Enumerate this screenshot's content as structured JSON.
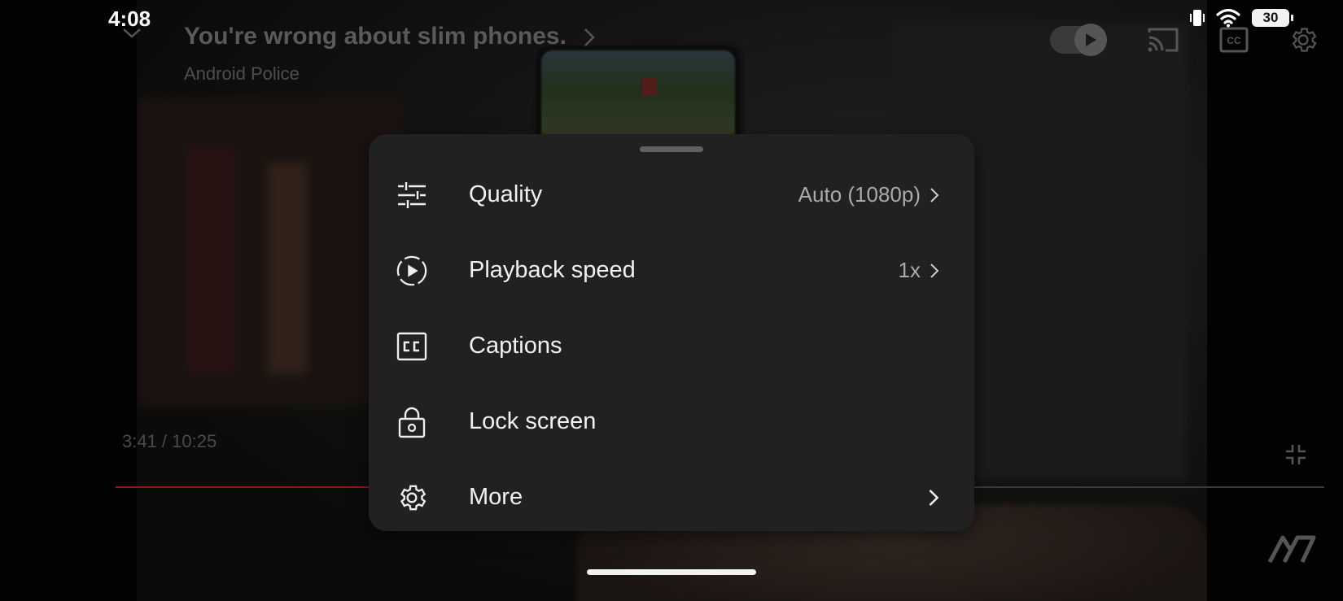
{
  "status_bar": {
    "time": "4:08",
    "battery": "30"
  },
  "player": {
    "title": "You're wrong about slim phones.",
    "channel": "Android Police",
    "current_time": "3:41",
    "duration": "10:25",
    "time_display": "3:41 / 10:25",
    "progress_fraction": 0.359,
    "autoplay_on": true
  },
  "menu": {
    "items": [
      {
        "icon": "quality-sliders-icon",
        "label": "Quality",
        "value": "Auto (1080p)",
        "has_chevron": true
      },
      {
        "icon": "playback-speed-icon",
        "label": "Playback speed",
        "value": "1x",
        "has_chevron": true
      },
      {
        "icon": "captions-icon",
        "label": "Captions",
        "value": "",
        "has_chevron": false
      },
      {
        "icon": "lock-icon",
        "label": "Lock screen",
        "value": "",
        "has_chevron": false
      },
      {
        "icon": "gear-icon",
        "label": "More",
        "value": "",
        "has_chevron": true
      }
    ]
  },
  "colors": {
    "sheet_background": "#212121",
    "progress_red": "#8a1a1a",
    "text_primary": "#f1f1f1",
    "text_secondary": "#aaaaaa"
  }
}
